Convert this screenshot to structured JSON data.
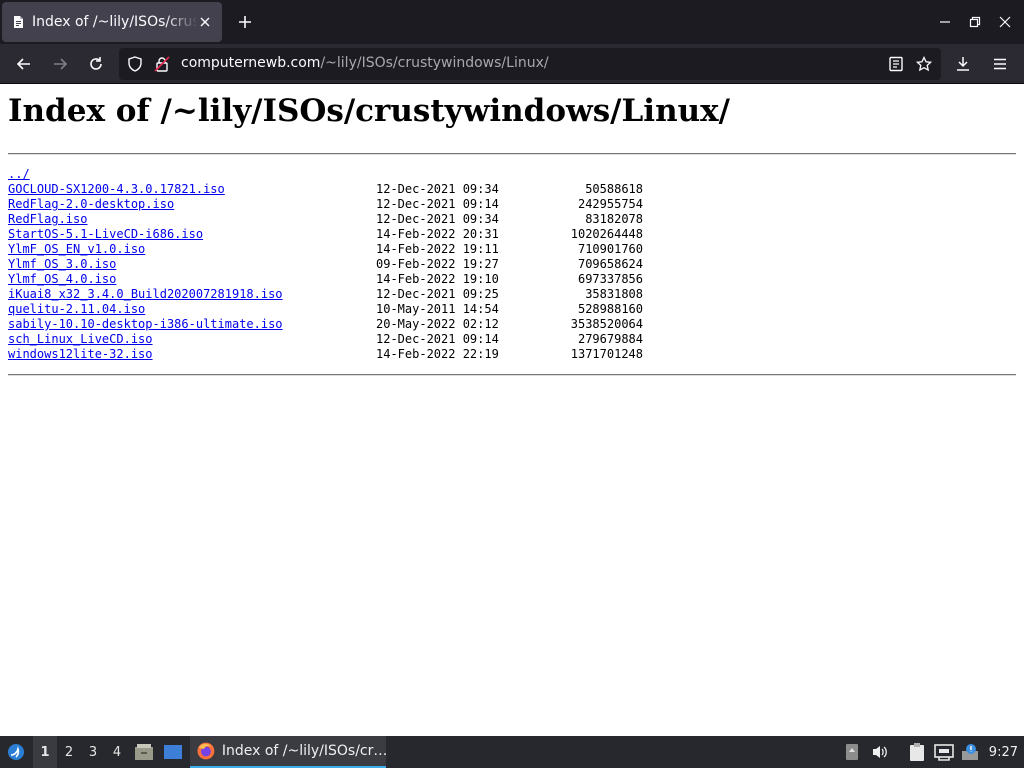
{
  "tab": {
    "title": "Index of /~lily/ISOs/crustywindows/Linux/",
    "icon": "page-favicon-icon"
  },
  "url": {
    "host": "computernewb.com",
    "path": "/~lily/ISOs/crustywindows/Linux/"
  },
  "page": {
    "title": "Index of /~lily/ISOs/crustywindows/Linux/",
    "parent_link": "../",
    "files": [
      {
        "name": "GOCLOUD-SX1200-4.3.0.17821.iso",
        "date": "12-Dec-2021 09:34",
        "size": "50588618"
      },
      {
        "name": "RedFlag-2.0-desktop.iso",
        "date": "12-Dec-2021 09:14",
        "size": "242955754"
      },
      {
        "name": "RedFlag.iso",
        "date": "12-Dec-2021 09:34",
        "size": "83182078"
      },
      {
        "name": "StartOS-5.1-LiveCD-i686.iso",
        "date": "14-Feb-2022 20:31",
        "size": "1020264448"
      },
      {
        "name": "YlmF_OS_EN_v1.0.iso",
        "date": "14-Feb-2022 19:11",
        "size": "710901760"
      },
      {
        "name": "Ylmf_OS_3.0.iso",
        "date": "09-Feb-2022 19:27",
        "size": "709658624"
      },
      {
        "name": "Ylmf_OS_4.0.iso",
        "date": "14-Feb-2022 19:10",
        "size": "697337856"
      },
      {
        "name": "iKuai8_x32_3.4.0_Build202007281918.iso",
        "date": "12-Dec-2021 09:25",
        "size": "35831808"
      },
      {
        "name": "quelitu-2.11.04.iso",
        "date": "10-May-2011 14:54",
        "size": "528988160"
      },
      {
        "name": "sabily-10.10-desktop-i386-ultimate.iso",
        "date": "20-May-2022 02:12",
        "size": "3538520064"
      },
      {
        "name": "sch_Linux_LiveCD.iso",
        "date": "12-Dec-2021 09:14",
        "size": "279679884"
      },
      {
        "name": "windows12lite-32.iso",
        "date": "14-Feb-2022 22:19",
        "size": "1371701248"
      }
    ]
  },
  "taskbar": {
    "workspaces": [
      "1",
      "2",
      "3",
      "4"
    ],
    "active_workspace": "1",
    "window_label": "Index of /~lily/ISOs/cr…",
    "clock": "9:27"
  },
  "colors": {
    "link": "#0000ee",
    "chrome_dark": "#1c1b22",
    "toolbar": "#2b2a33",
    "taskbar": "#27282d",
    "accent": "#3daee9"
  }
}
